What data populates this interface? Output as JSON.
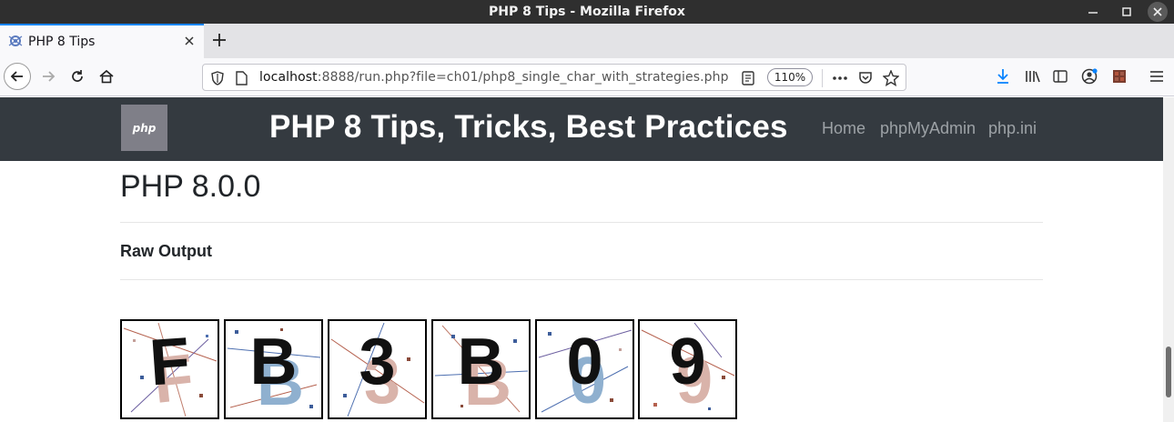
{
  "window": {
    "title": "PHP 8 Tips - Mozilla Firefox"
  },
  "tabs": [
    {
      "label": "PHP 8 Tips",
      "active": true
    }
  ],
  "urlbar": {
    "host": "localhost",
    "rest": ":8888/run.php?file=ch01/php8_single_char_with_strategies.php",
    "zoom": "110%"
  },
  "page": {
    "logo_text": "php",
    "title": "PHP 8 Tips, Tricks, Best Practices",
    "nav": [
      "Home",
      "phpMyAdmin",
      "php.ini"
    ],
    "version": "PHP 8.0.0",
    "section_heading": "Raw Output",
    "captcha_chars": [
      "F",
      "B",
      "3",
      "B",
      "0",
      "9"
    ]
  },
  "colors": {
    "header_bg": "#343a40",
    "nav_link": "#9da2a6",
    "accent": "#0a84ff",
    "download_icon": "#0a84ff"
  },
  "icons": {
    "back": "arrow-left-icon",
    "forward": "arrow-right-icon",
    "reload": "reload-icon",
    "home": "home-icon",
    "shield": "shield-icon",
    "page": "page-icon",
    "reader": "reader-view-icon",
    "more": "more-icon",
    "pocket": "pocket-icon",
    "bookmark": "star-icon",
    "download": "download-icon",
    "library": "library-icon",
    "sidebar": "sidebar-icon",
    "account": "account-icon",
    "extension": "extension-icon",
    "menu": "hamburger-menu-icon"
  }
}
